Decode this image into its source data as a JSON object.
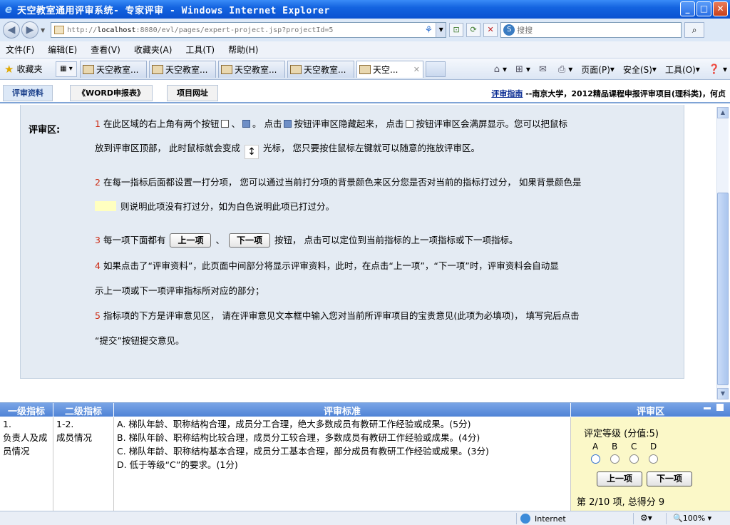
{
  "window": {
    "title": "天空教室通用评审系统- 专家评审 - Windows Internet Explorer",
    "min": "_",
    "max": "□",
    "close": "✕"
  },
  "addressbar": {
    "url_prefix": "http://",
    "url_host": "localhost",
    "url_rest": ":8080/evl/pages/expert-project.jsp?projectId=5",
    "search_placeholder": "搜搜"
  },
  "menu": [
    "文件(F)",
    "编辑(E)",
    "查看(V)",
    "收藏夹(A)",
    "工具(T)",
    "帮助(H)"
  ],
  "favorites_label": "收藏夹",
  "tabs": [
    "天空教室...",
    "天空教室...",
    "天空教室...",
    "天空教室...",
    "天空..."
  ],
  "commands": {
    "page": "页面(P)",
    "safety": "安全(S)",
    "tools": "工具(O)"
  },
  "apptabs": {
    "materials": "评审资料",
    "word": "《WORD申报表》",
    "site": "项目网址"
  },
  "breadcrumb": {
    "link": "评审指南",
    "text": "--南京大学，2012精品课程申报评审项目(理科类)，何贞"
  },
  "help": {
    "title": "评审区:",
    "item1_num": "1",
    "item1_a": "在此区域的右上角有两个按钮",
    "item1_sep": "、",
    "item1_b": "。  点击",
    "item1_c": "按钮评审区隐藏起来，  点击",
    "item1_d": "按钮评审区会满屏显示。您可以把鼠标",
    "item1_line2_a": "放到评审区顶部，  此时鼠标就会变成",
    "item1_line2_b": "光标，  您只要按住鼠标左键就可以随意的拖放评审区。",
    "item2_num": "2",
    "item2_a": "在每一指标后面都设置一打分项，  您可以通过当前打分项的背景颜色来区分您是否对当前的指标打过分，  如果背景颜色是",
    "item2_b": "则说明此项没有打过分，如为白色说明此项已打过分。",
    "item3_num": "3",
    "item3_a": "每一项下面都有",
    "item3_prev": "上一项",
    "item3_sep": "、",
    "item3_next": "下一项",
    "item3_b": "按钮，  点击可以定位到当前指标的上一项指标或下一项指标。",
    "item4_num": "4",
    "item4_a": "如果点击了“评审资料”，此页面中间部分将显示评审资料，此时，在点击“上一项”，“下一项”时，评审资料会自动显",
    "item4_b": "示上一项或下一项评审指标所对应的部分；",
    "item5_num": "5",
    "item5_a": "指标项的下方是评审意见区，  请在评审意见文本框中输入您对当前所评审项目的宝贵意见(此项为必填项)，  填写完后点击",
    "item5_b": "“提交”按钮提交意见。"
  },
  "eval": {
    "headers": {
      "level1": "一级指标",
      "level2": "二级指标",
      "criteria": "评审标准",
      "rating": "评审区"
    },
    "level1_num": "1.",
    "level1_text": "负责人及成员情况",
    "level2_num": "1-2.",
    "level2_text": "成员情况",
    "criteria": [
      "A. 梯队年龄、职称结构合理，成员分工合理，绝大多数成员有教研工作经验或成果。(5分)",
      "B. 梯队年龄、职称结构比较合理，成员分工较合理，多数成员有教研工作经验或成果。(4分)",
      "C. 梯队年龄、职称结构基本合理，成员分工基本合理，部分成员有教研工作经验或成果。(3分)",
      "D. 低于等级“C”的要求。(1分)"
    ],
    "rating_label": "评定等级 (分值:5)",
    "grades": [
      "A",
      "B",
      "C",
      "D"
    ],
    "prev": "上一项",
    "next": "下一项",
    "progress": "第 2/10 项, 总得分 9"
  },
  "status": {
    "zone": "Internet",
    "zoom": "100%"
  }
}
